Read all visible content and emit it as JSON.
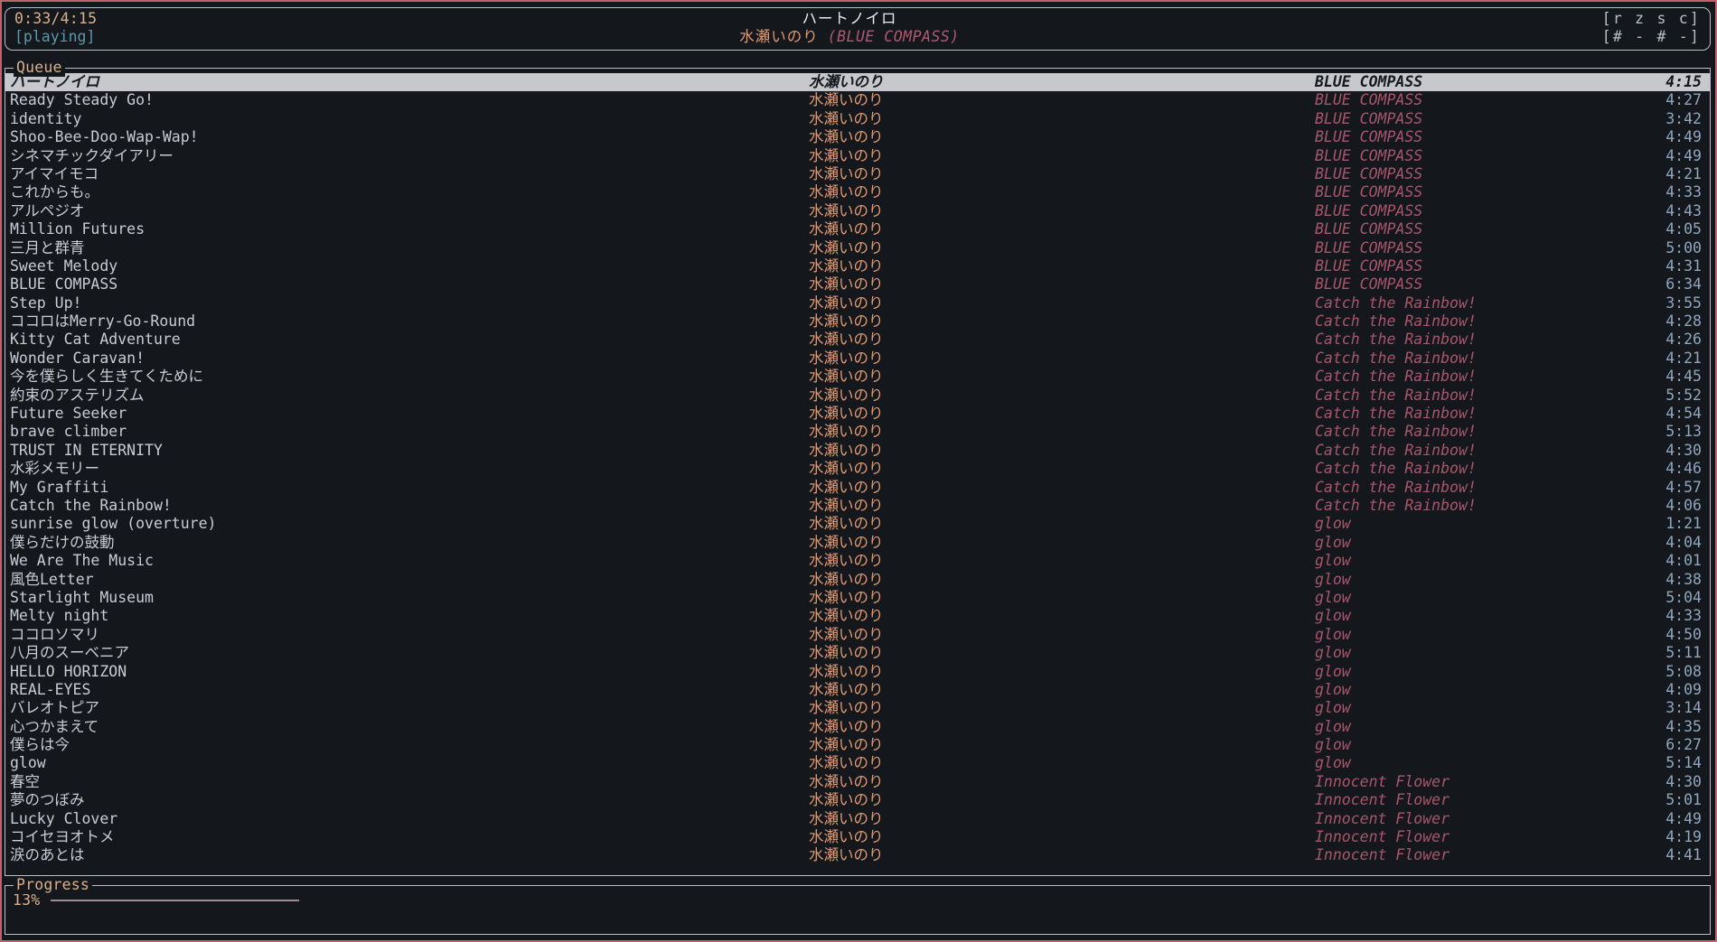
{
  "window": {
    "border_color": "#c0626d",
    "bg": "#14171c"
  },
  "header": {
    "time": "0:33/4:15",
    "status": "[playing]",
    "now_playing": {
      "title": "ハートノイロ",
      "artist": "水瀬いのり",
      "album": "(BLUE COMPASS)"
    },
    "modes": {
      "keys": "[r z s c]",
      "states": "[# - # -]"
    }
  },
  "queue": {
    "legend": "Queue",
    "columns": [
      "title",
      "artist",
      "album",
      "duration"
    ],
    "rows": [
      {
        "title": "ハートノイロ",
        "artist": "水瀬いのり",
        "album": "BLUE COMPASS",
        "duration": "4:15",
        "selected": true
      },
      {
        "title": "Ready Steady Go!",
        "artist": "水瀬いのり",
        "album": "BLUE COMPASS",
        "duration": "4:27",
        "selected": false
      },
      {
        "title": "identity",
        "artist": "水瀬いのり",
        "album": "BLUE COMPASS",
        "duration": "3:42",
        "selected": false
      },
      {
        "title": "Shoo-Bee-Doo-Wap-Wap!",
        "artist": "水瀬いのり",
        "album": "BLUE COMPASS",
        "duration": "4:49",
        "selected": false
      },
      {
        "title": "シネマチックダイアリー",
        "artist": "水瀬いのり",
        "album": "BLUE COMPASS",
        "duration": "4:49",
        "selected": false
      },
      {
        "title": "アイマイモコ",
        "artist": "水瀬いのり",
        "album": "BLUE COMPASS",
        "duration": "4:21",
        "selected": false
      },
      {
        "title": "これからも。",
        "artist": "水瀬いのり",
        "album": "BLUE COMPASS",
        "duration": "4:33",
        "selected": false
      },
      {
        "title": "アルペジオ",
        "artist": "水瀬いのり",
        "album": "BLUE COMPASS",
        "duration": "4:43",
        "selected": false
      },
      {
        "title": "Million Futures",
        "artist": "水瀬いのり",
        "album": "BLUE COMPASS",
        "duration": "4:05",
        "selected": false
      },
      {
        "title": "三月と群青",
        "artist": "水瀬いのり",
        "album": "BLUE COMPASS",
        "duration": "5:00",
        "selected": false
      },
      {
        "title": "Sweet Melody",
        "artist": "水瀬いのり",
        "album": "BLUE COMPASS",
        "duration": "4:31",
        "selected": false
      },
      {
        "title": "BLUE COMPASS",
        "artist": "水瀬いのり",
        "album": "BLUE COMPASS",
        "duration": "6:34",
        "selected": false
      },
      {
        "title": "Step Up!",
        "artist": "水瀬いのり",
        "album": "Catch the Rainbow!",
        "duration": "3:55",
        "selected": false
      },
      {
        "title": "ココロはMerry-Go-Round",
        "artist": "水瀬いのり",
        "album": "Catch the Rainbow!",
        "duration": "4:28",
        "selected": false
      },
      {
        "title": "Kitty Cat Adventure",
        "artist": "水瀬いのり",
        "album": "Catch the Rainbow!",
        "duration": "4:26",
        "selected": false
      },
      {
        "title": "Wonder Caravan!",
        "artist": "水瀬いのり",
        "album": "Catch the Rainbow!",
        "duration": "4:21",
        "selected": false
      },
      {
        "title": "今を僕らしく生きてくために",
        "artist": "水瀬いのり",
        "album": "Catch the Rainbow!",
        "duration": "4:45",
        "selected": false
      },
      {
        "title": "約束のアステリズム",
        "artist": "水瀬いのり",
        "album": "Catch the Rainbow!",
        "duration": "5:52",
        "selected": false
      },
      {
        "title": "Future Seeker",
        "artist": "水瀬いのり",
        "album": "Catch the Rainbow!",
        "duration": "4:54",
        "selected": false
      },
      {
        "title": "brave climber",
        "artist": "水瀬いのり",
        "album": "Catch the Rainbow!",
        "duration": "5:13",
        "selected": false
      },
      {
        "title": "TRUST IN ETERNITY",
        "artist": "水瀬いのり",
        "album": "Catch the Rainbow!",
        "duration": "4:30",
        "selected": false
      },
      {
        "title": "水彩メモリー",
        "artist": "水瀬いのり",
        "album": "Catch the Rainbow!",
        "duration": "4:46",
        "selected": false
      },
      {
        "title": "My Graffiti",
        "artist": "水瀬いのり",
        "album": "Catch the Rainbow!",
        "duration": "4:57",
        "selected": false
      },
      {
        "title": "Catch the Rainbow!",
        "artist": "水瀬いのり",
        "album": "Catch the Rainbow!",
        "duration": "4:06",
        "selected": false
      },
      {
        "title": "sunrise glow (overture)",
        "artist": "水瀬いのり",
        "album": "glow",
        "duration": "1:21",
        "selected": false
      },
      {
        "title": "僕らだけの鼓動",
        "artist": "水瀬いのり",
        "album": "glow",
        "duration": "4:04",
        "selected": false
      },
      {
        "title": "We Are The Music",
        "artist": "水瀬いのり",
        "album": "glow",
        "duration": "4:01",
        "selected": false
      },
      {
        "title": "風色Letter",
        "artist": "水瀬いのり",
        "album": "glow",
        "duration": "4:38",
        "selected": false
      },
      {
        "title": "Starlight Museum",
        "artist": "水瀬いのり",
        "album": "glow",
        "duration": "5:04",
        "selected": false
      },
      {
        "title": "Melty night",
        "artist": "水瀬いのり",
        "album": "glow",
        "duration": "4:33",
        "selected": false
      },
      {
        "title": "ココロソマリ",
        "artist": "水瀬いのり",
        "album": "glow",
        "duration": "4:50",
        "selected": false
      },
      {
        "title": "八月のスーベニア",
        "artist": "水瀬いのり",
        "album": "glow",
        "duration": "5:11",
        "selected": false
      },
      {
        "title": "HELLO HORIZON",
        "artist": "水瀬いのり",
        "album": "glow",
        "duration": "5:08",
        "selected": false
      },
      {
        "title": "REAL-EYES",
        "artist": "水瀬いのり",
        "album": "glow",
        "duration": "4:09",
        "selected": false
      },
      {
        "title": "バレオトピア",
        "artist": "水瀬いのり",
        "album": "glow",
        "duration": "3:14",
        "selected": false
      },
      {
        "title": "心つかまえて",
        "artist": "水瀬いのり",
        "album": "glow",
        "duration": "4:35",
        "selected": false
      },
      {
        "title": "僕らは今",
        "artist": "水瀬いのり",
        "album": "glow",
        "duration": "6:27",
        "selected": false
      },
      {
        "title": "glow",
        "artist": "水瀬いのり",
        "album": "glow",
        "duration": "5:14",
        "selected": false
      },
      {
        "title": "春空",
        "artist": "水瀬いのり",
        "album": "Innocent Flower",
        "duration": "4:30",
        "selected": false
      },
      {
        "title": "夢のつぼみ",
        "artist": "水瀬いのり",
        "album": "Innocent Flower",
        "duration": "5:01",
        "selected": false
      },
      {
        "title": "Lucky Clover",
        "artist": "水瀬いのり",
        "album": "Innocent Flower",
        "duration": "4:49",
        "selected": false
      },
      {
        "title": "コイセヨオトメ",
        "artist": "水瀬いのり",
        "album": "Innocent Flower",
        "duration": "4:19",
        "selected": false
      },
      {
        "title": "涙のあとは",
        "artist": "水瀬いのり",
        "album": "Innocent Flower",
        "duration": "4:41",
        "selected": false
      }
    ]
  },
  "progress": {
    "legend": "Progress",
    "percent_label": "13%",
    "percent_value": 13,
    "bar_fill_width": "15%"
  }
}
